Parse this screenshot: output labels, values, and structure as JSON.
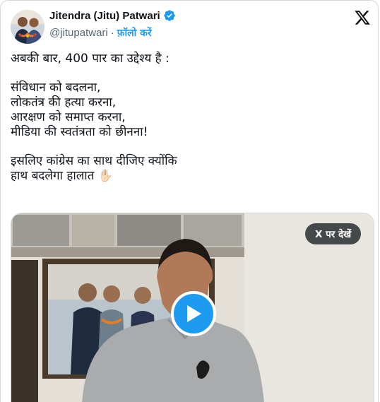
{
  "author": {
    "name": "Jitendra (Jitu) Patwari",
    "handle": "@jitupatwari",
    "separator": "·",
    "follow_label": "फ़ॉलो करें",
    "verified_icon": "verified-badge-icon",
    "avatar_icon": "profile-photo"
  },
  "platform": {
    "logo_icon": "x-logo-icon"
  },
  "tweet": {
    "lines": [
      "अबकी बार, 400 पार का उद्देश्य है :",
      "संविधान को बदलना,",
      "लोकतंत्र की हत्या करना,",
      "आरक्षण को समाप्त करना,",
      "मीडिया की स्वतंत्रता को छीनना!",
      "इसलिए कांग्रेस का साथ दीजिए क्योंकि",
      "हाथ बदलेगा हालात ✋🏻"
    ]
  },
  "media": {
    "watch_label": "X पर देखें",
    "play_icon": "play-icon",
    "thumbnail": "video-thumbnail"
  },
  "colors": {
    "accent": "#1d9bf0",
    "text": "#0f1419",
    "muted": "#536471",
    "border": "#cfd9de"
  }
}
